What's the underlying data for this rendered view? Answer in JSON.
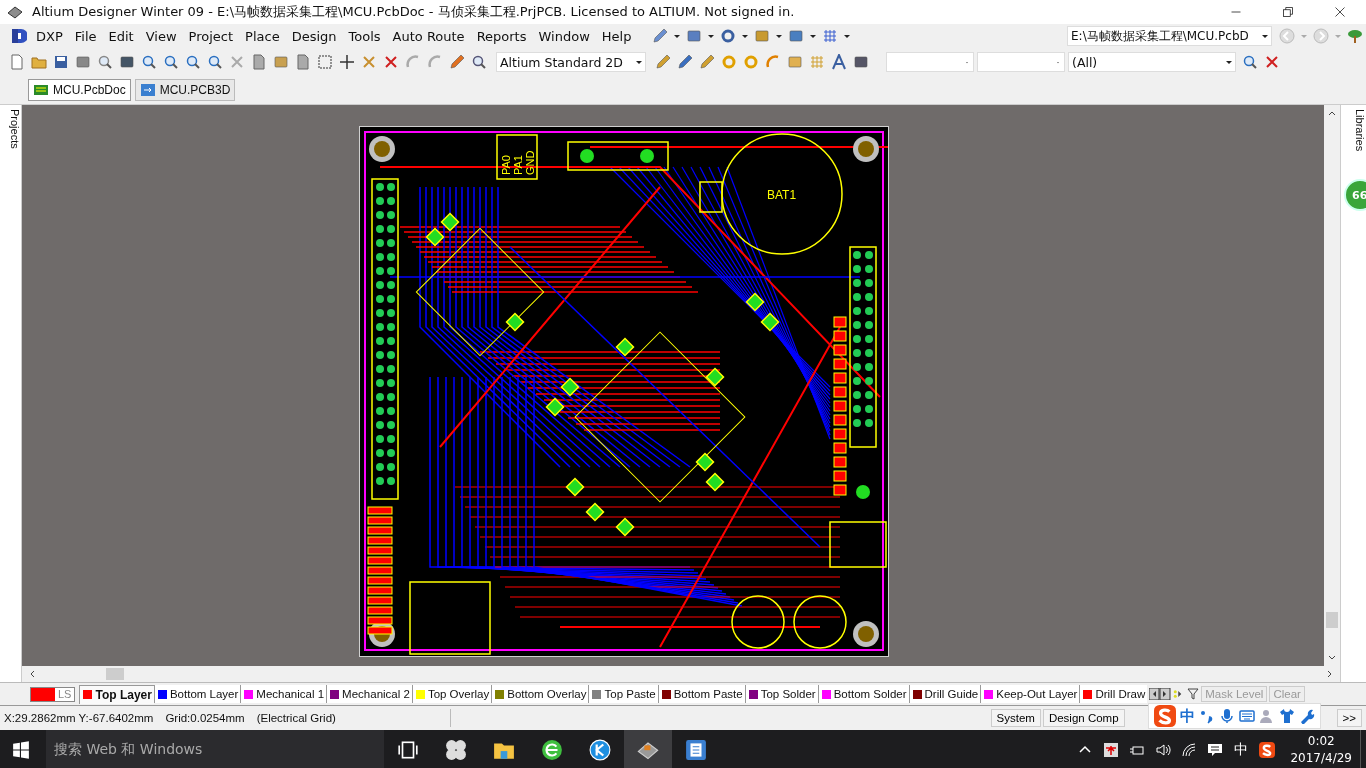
{
  "window": {
    "title": "Altium Designer Winter 09 - E:\\马帧数据采集工程\\MCU.PcbDoc - 马侦采集工程.PrjPCB. Licensed to ALTIUM. Not signed in."
  },
  "menu": [
    "DXP",
    "File",
    "Edit",
    "View",
    "Project",
    "Place",
    "Design",
    "Tools",
    "Auto Route",
    "Reports",
    "Window",
    "Help"
  ],
  "toolbar": {
    "document_path": "E:\\马帧数据采集工程\\MCU.PcbD",
    "view_mode": "Altium Standard 2D",
    "filter": "(All)"
  },
  "side_panels": {
    "left": "Projects",
    "right": "Libraries"
  },
  "document_tabs": [
    {
      "label": "MCU.PcbDoc",
      "selected": true
    },
    {
      "label": "MCU.PCB3D",
      "selected": false
    }
  ],
  "board": {
    "header_labels": [
      "PA0",
      "PA1",
      "GND"
    ],
    "battery_label": "BAT1"
  },
  "floating_badge": "66",
  "layer_bar": {
    "current": "LS",
    "layers": [
      {
        "label": "Top Layer",
        "color": "#ff0000",
        "selected": true
      },
      {
        "label": "Bottom Layer",
        "color": "#0000ff",
        "selected": false
      },
      {
        "label": "Mechanical 1",
        "color": "#ff00ff",
        "selected": false
      },
      {
        "label": "Mechanical 2",
        "color": "#800080",
        "selected": false
      },
      {
        "label": "Top Overlay",
        "color": "#ffff00",
        "selected": false
      },
      {
        "label": "Bottom Overlay",
        "color": "#808000",
        "selected": false
      },
      {
        "label": "Top Paste",
        "color": "#808080",
        "selected": false
      },
      {
        "label": "Bottom Paste",
        "color": "#800000",
        "selected": false
      },
      {
        "label": "Top Solder",
        "color": "#800080",
        "selected": false
      },
      {
        "label": "Bottom Solder",
        "color": "#ff00ff",
        "selected": false
      },
      {
        "label": "Drill Guide",
        "color": "#800000",
        "selected": false
      },
      {
        "label": "Keep-Out Layer",
        "color": "#ff00ff",
        "selected": false
      },
      {
        "label": "Drill Draw",
        "color": "#ff0000",
        "selected": false
      }
    ],
    "buttons": [
      "Mask Level",
      "Clear"
    ]
  },
  "status_bar": {
    "coordinates": "X:29.2862mm Y:-67.6402mm",
    "grid": "Grid:0.0254mm",
    "grid_type": "(Electrical Grid)",
    "panel_buttons": [
      "System",
      "Design Comp"
    ],
    "more": ">>"
  },
  "ime_toolbar": {
    "mode": "中"
  },
  "taskbar": {
    "search_placeholder": "搜索 Web 和 Windows",
    "language": "中",
    "time": "0:02",
    "date": "2017/4/29"
  }
}
